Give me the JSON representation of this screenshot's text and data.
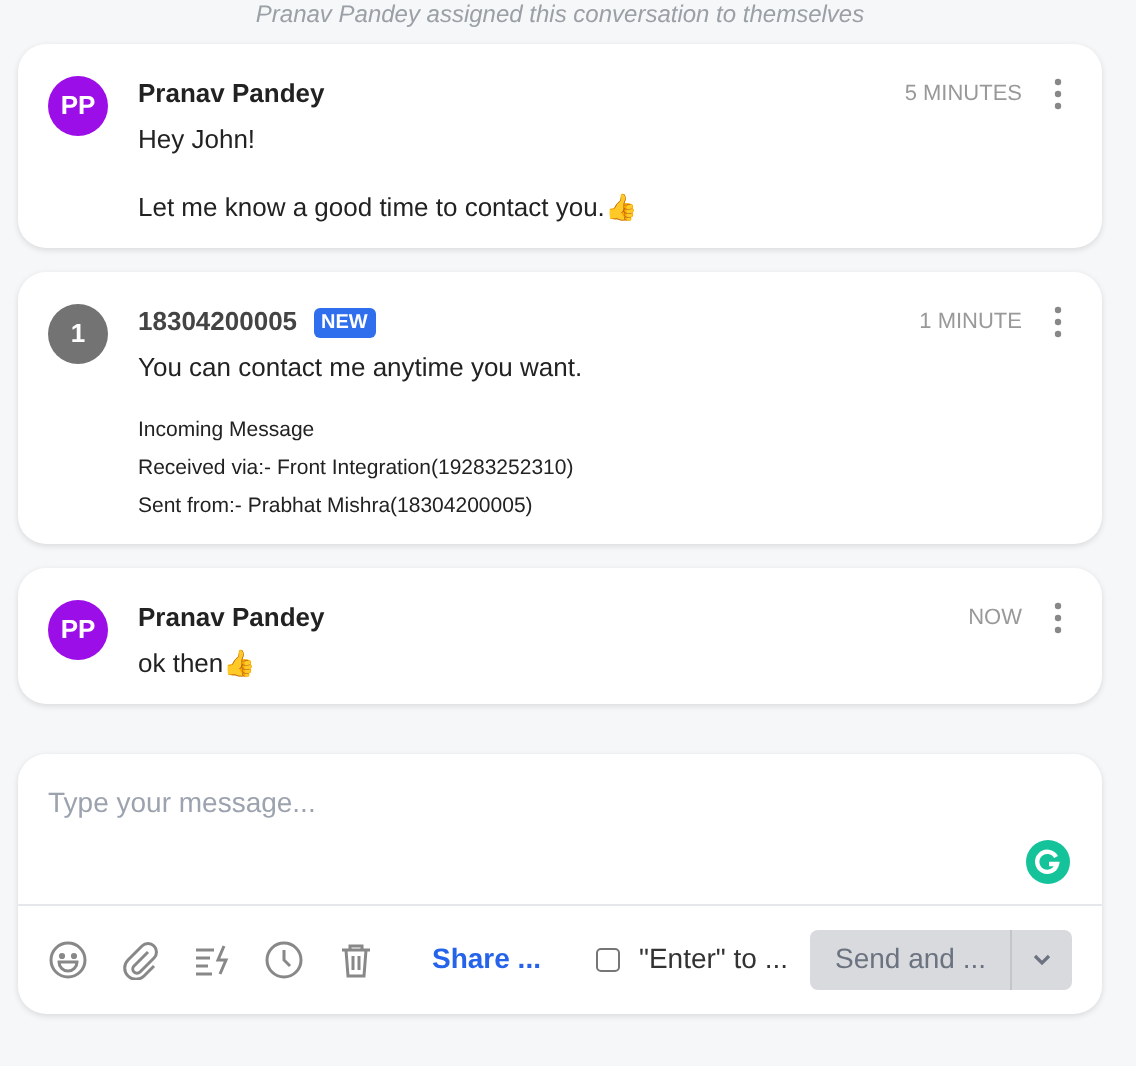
{
  "activity_note": "Pranav Pandey assigned this conversation to themselves",
  "messages": [
    {
      "kind": "agent",
      "avatar": "PP",
      "sender": "Pranav Pandey",
      "time": "5 MINUTES",
      "paragraphs": [
        "Hey John!",
        "Let me know a good time to contact you.👍"
      ]
    },
    {
      "kind": "contact",
      "avatar": "1",
      "sender": "18304200005",
      "badge": "NEW",
      "time": "1 MINUTE",
      "paragraphs": [
        "You can contact me anytime you want."
      ],
      "details": [
        "Incoming Message",
        "Received via:- Front Integration(19283252310)",
        "Sent from:- Prabhat Mishra(18304200005)"
      ]
    },
    {
      "kind": "agent",
      "avatar": "PP",
      "sender": "Pranav Pandey",
      "time": "NOW",
      "paragraphs": [
        "ok then👍"
      ]
    }
  ],
  "composer": {
    "placeholder": "Type your message...",
    "share_link": "Share ...",
    "enter_option": {
      "label": "\"Enter\" to ...",
      "checked": false
    },
    "send_button": "Send and ..."
  }
}
